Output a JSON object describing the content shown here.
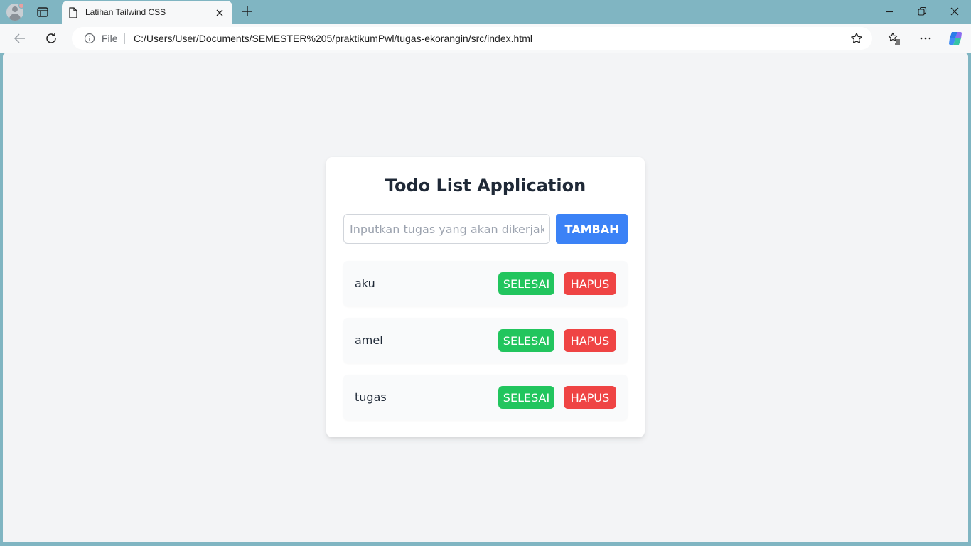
{
  "browser": {
    "tab": {
      "title": "Latihan Tailwind CSS"
    },
    "address": {
      "scheme_label": "File",
      "url": "C:/Users/User/Documents/SEMESTER%205/praktikumPwl/tugas-ekorangin/src/index.html"
    },
    "icons": [
      "profile-icon",
      "tab-actions-icon",
      "document-icon",
      "close-icon",
      "plus-icon",
      "minimize-icon",
      "restore-icon",
      "close-window-icon",
      "back-arrow-icon",
      "refresh-icon",
      "info-icon",
      "star-icon",
      "favorites-icon",
      "more-icon",
      "copilot-icon"
    ]
  },
  "app": {
    "title": "Todo List Application",
    "input": {
      "value": "",
      "placeholder": "Inputkan tugas yang akan dikerjakan ..."
    },
    "add_button": "TAMBAH",
    "todos": [
      {
        "text": "aku",
        "done_label": "SELESAI",
        "delete_label": "HAPUS"
      },
      {
        "text": "amel",
        "done_label": "SELESAI",
        "delete_label": "HAPUS"
      },
      {
        "text": "tugas",
        "done_label": "SELESAI",
        "delete_label": "HAPUS"
      }
    ]
  },
  "colors": {
    "frame": "#80b5c2",
    "page_bg": "#f3f4f6",
    "primary": "#3b82f6",
    "success": "#22c55e",
    "danger": "#ef4444"
  }
}
